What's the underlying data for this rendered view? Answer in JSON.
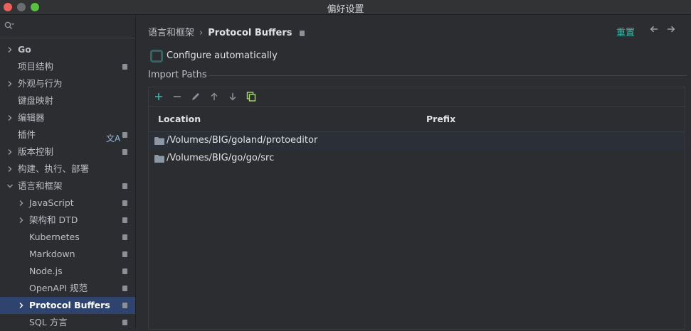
{
  "window": {
    "title": "偏好设置"
  },
  "colors": {
    "close": "#ec5f5a",
    "minimize": "#6b6d70",
    "zoom": "#58c13f",
    "accent": "#3fb6a8",
    "selection": "#2e436e"
  },
  "search": {
    "placeholder": "",
    "icon": "search-icon"
  },
  "sidebar": {
    "items": [
      {
        "label": "Go",
        "chevron": true,
        "indent": 0,
        "bold": true,
        "pinned": false
      },
      {
        "label": "项目结构",
        "chevron": false,
        "indent": 0,
        "pinned": true
      },
      {
        "label": "外观与行为",
        "chevron": true,
        "indent": 0,
        "pinned": false
      },
      {
        "label": "键盘映射",
        "chevron": false,
        "indent": 0,
        "pinned": false
      },
      {
        "label": "编辑器",
        "chevron": true,
        "indent": 0,
        "pinned": false
      },
      {
        "label": "插件",
        "chevron": false,
        "indent": 0,
        "pinned": true,
        "translate_icon": "translate-icon"
      },
      {
        "label": "版本控制",
        "chevron": true,
        "indent": 0,
        "pinned": true
      },
      {
        "label": "构建、执行、部署",
        "chevron": true,
        "indent": 0,
        "pinned": false
      },
      {
        "label": "语言和框架",
        "chevron": true,
        "expanded": true,
        "indent": 0,
        "pinned": true
      },
      {
        "label": "JavaScript",
        "chevron": true,
        "indent": 1,
        "pinned": true
      },
      {
        "label": "架构和 DTD",
        "chevron": true,
        "indent": 1,
        "pinned": true
      },
      {
        "label": "Kubernetes",
        "chevron": false,
        "indent": 1,
        "pinned": true
      },
      {
        "label": "Markdown",
        "chevron": false,
        "indent": 1,
        "pinned": true
      },
      {
        "label": "Node.js",
        "chevron": false,
        "indent": 1,
        "pinned": true
      },
      {
        "label": "OpenAPI 规范",
        "chevron": false,
        "indent": 1,
        "pinned": true
      },
      {
        "label": "Protocol Buffers",
        "chevron": true,
        "indent": 1,
        "pinned": true,
        "selected": true
      },
      {
        "label": "SQL 方言",
        "chevron": false,
        "indent": 1,
        "pinned": true
      }
    ]
  },
  "breadcrumb": {
    "parent": "语言和框架",
    "separator": "›",
    "current": "Protocol Buffers"
  },
  "header": {
    "reset_label": "重置",
    "back_icon": "arrow-left-icon",
    "forward_icon": "arrow-right-icon"
  },
  "configure": {
    "label": "Configure automatically",
    "checked": false
  },
  "import_paths": {
    "title": "Import Paths",
    "toolbar": [
      "add-icon",
      "remove-icon",
      "edit-icon",
      "move-up-icon",
      "move-down-icon",
      "copy-icon"
    ],
    "columns": {
      "location": "Location",
      "prefix": "Prefix"
    },
    "rows": [
      {
        "location": "/Volumes/BIG/goland/protoeditor",
        "prefix": ""
      },
      {
        "location": "/Volumes/BIG/go/go/src",
        "prefix": ""
      }
    ]
  }
}
